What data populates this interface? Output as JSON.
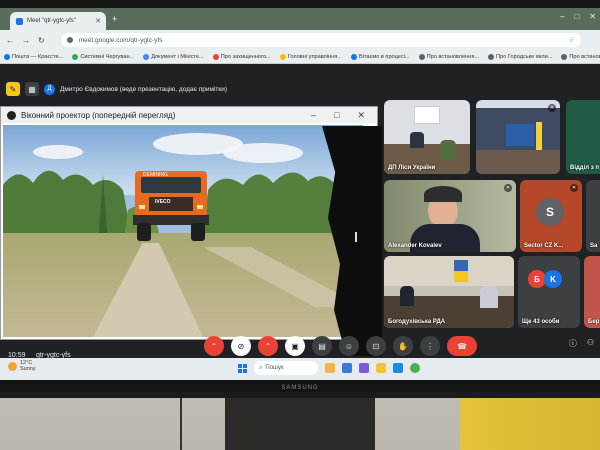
{
  "browser": {
    "tab_title": "Meet \"qtr-ygtc-yfs\"",
    "url": "meet.google.com/qtr-ygtc-yfs",
    "bookmarks": [
      "Пошта — Краєсте...",
      "Системні Чергуван...",
      "Документ і Міністе...",
      "Про захищенного...",
      "Головні управління...",
      "Вітаємо в процесі...",
      "Про встановлення...",
      "Про Городське вкли...",
      "Про встановлення..."
    ],
    "bookmark_colors": [
      "#1a73e8",
      "#34a853",
      "#4285f4",
      "#ea4335",
      "#fbbc04",
      "#1a73e8",
      "#5f6368",
      "#5f6368",
      "#5f6368"
    ]
  },
  "meet": {
    "presenter_avatar": "Д",
    "presenter_text": "Дмитро Євдокимов (веде презентацію, додає примітки)",
    "projector_title": "Віконний проектор (попередній перегляд)",
    "truck_brand": "IVECO",
    "truck_banner": "DEMINING",
    "meeting_time": "10:59",
    "meeting_code": "qtr-ygtc-yfs",
    "tiles": [
      {
        "name": "ДП Ліси України",
        "kind": "video"
      },
      {
        "name": "",
        "kind": "video"
      },
      {
        "name": "Відділ з п",
        "kind": "video"
      },
      {
        "name": "Alexander Kovalev",
        "kind": "video"
      },
      {
        "name": "Sector CZ K...",
        "kind": "avatar",
        "initial": "S"
      },
      {
        "name": "Sa",
        "kind": "partial"
      },
      {
        "name": "Богодухівська РДА",
        "kind": "video"
      },
      {
        "name": "Ще 43 особи",
        "kind": "more",
        "initials": [
          "Б",
          "K"
        ]
      },
      {
        "name": "Бер",
        "kind": "partial"
      }
    ]
  },
  "taskbar": {
    "weather_temp": "12°C",
    "weather_desc": "Sunny",
    "search_placeholder": "Пошук"
  },
  "monitor": {
    "brand": "SAMSUNG"
  }
}
